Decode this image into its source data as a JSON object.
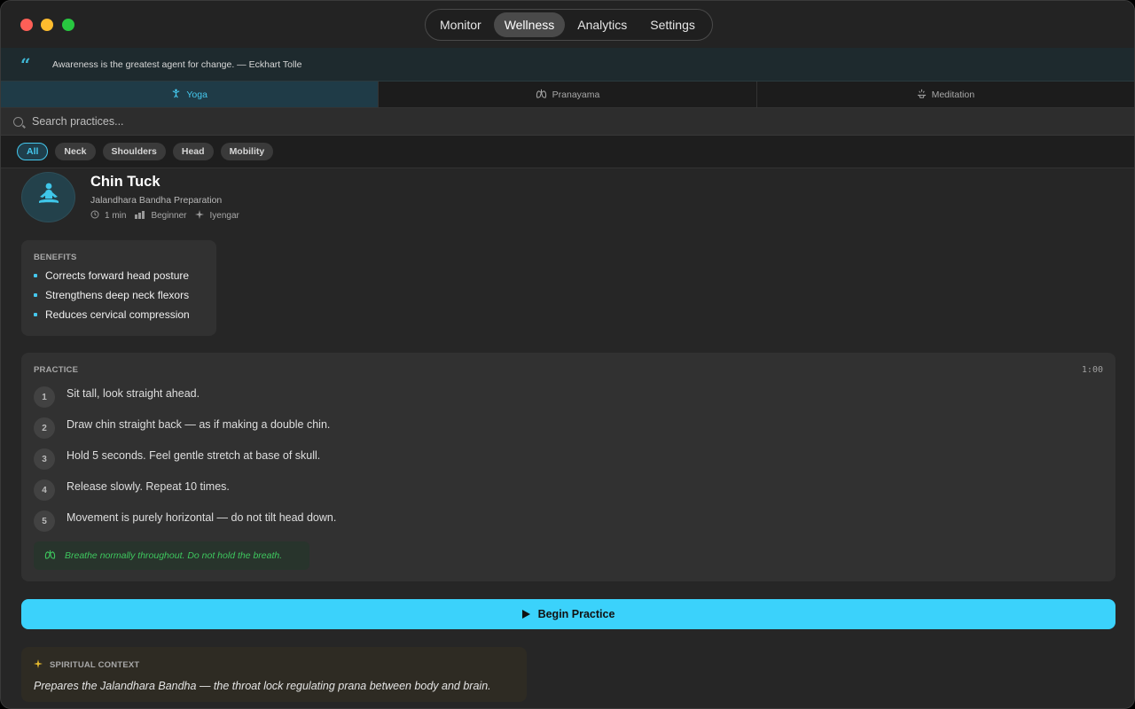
{
  "window": {
    "nav": [
      "Monitor",
      "Wellness",
      "Analytics",
      "Settings"
    ],
    "active_nav": "Wellness"
  },
  "quote": {
    "text": "Awareness is the greatest agent for change. — Eckhart Tolle"
  },
  "tabs": [
    {
      "label": "Yoga",
      "icon": "yoga-icon",
      "active": true
    },
    {
      "label": "Pranayama",
      "icon": "lungs-icon",
      "active": false
    },
    {
      "label": "Meditation",
      "icon": "meditation-icon",
      "active": false
    }
  ],
  "search": {
    "placeholder": "Search practices..."
  },
  "filters": [
    "All",
    "Neck",
    "Shoulders",
    "Head",
    "Mobility"
  ],
  "practice": {
    "title": "Chin Tuck",
    "subtitle": "Jalandhara Bandha Preparation",
    "duration": "1 min",
    "level": "Beginner",
    "style": "Iyengar",
    "benefits_heading": "BENEFITS",
    "benefits": [
      "Corrects forward head posture",
      "Strengthens deep neck flexors",
      "Reduces cervical compression"
    ],
    "practice_heading": "PRACTICE",
    "timer": "1:00",
    "steps": [
      {
        "num": "1",
        "text": "Sit tall, look straight ahead."
      },
      {
        "num": "2",
        "text": "Draw chin straight back — as if making a double chin."
      },
      {
        "num": "3",
        "text": "Hold 5 seconds. Feel gentle stretch at base of skull."
      },
      {
        "num": "4",
        "text": "Release slowly. Repeat 10 times."
      },
      {
        "num": "5",
        "text": "Movement is purely horizontal — do not tilt head down."
      }
    ],
    "breath_note": "Breathe normally throughout. Do not hold the breath.",
    "begin_label": "Begin Practice",
    "spiritual_heading": "SPIRITUAL CONTEXT",
    "spiritual_text": "Prepares the Jalandhara Bandha — the throat lock regulating prana between body and brain."
  },
  "colors": {
    "accent": "#3bd2fb",
    "breath_green": "#3ec75e",
    "spiritual_gold": "#e5b92e"
  }
}
